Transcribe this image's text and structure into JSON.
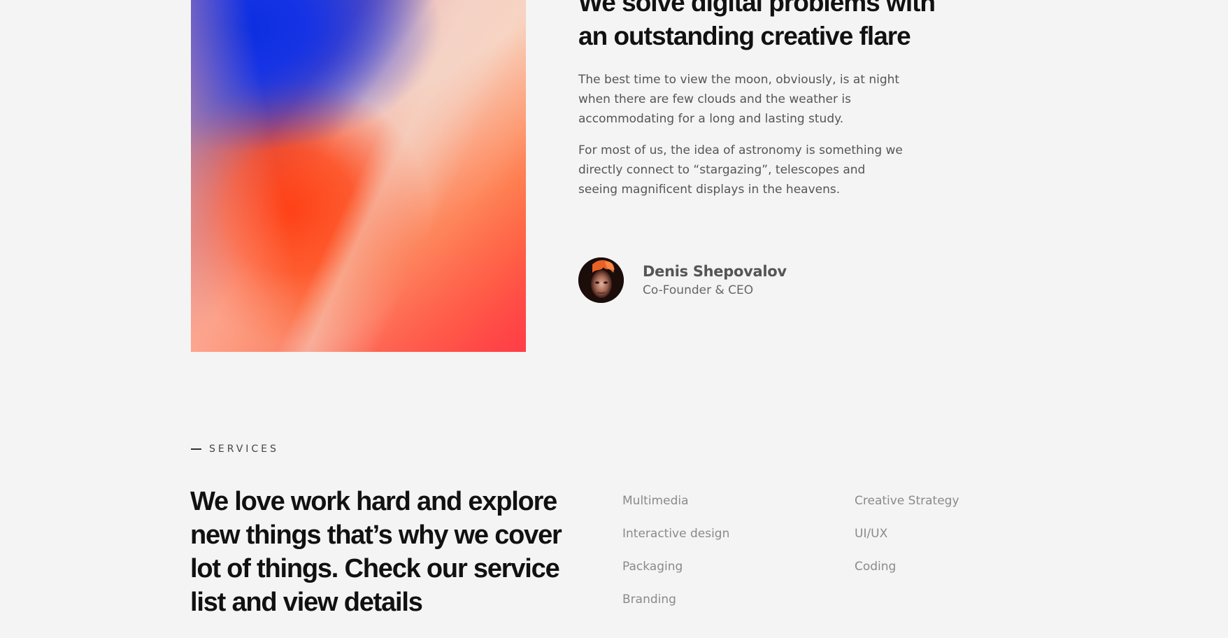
{
  "about": {
    "heading": "We solve digital problems with an outstanding creative flare",
    "paragraphs": [
      "The best time to view the moon, obviously, is at night when there are few clouds and the weather is accommodating for a long and lasting study.",
      "For most of us, the idea of astronomy is something we directly connect to “stargazing”, telescopes and seeing magnificent displays in the heavens."
    ],
    "author": {
      "name": "Denis Shepovalov",
      "role": "Co-Founder & CEO"
    }
  },
  "services": {
    "label": "SERVICES",
    "heading": "We love work hard and explore new things that’s why we cover lot of things. Check our service list and view details",
    "column_1": [
      "Multimedia",
      "Interactive design",
      "Packaging",
      "Branding"
    ],
    "column_2": [
      "Creative Strategy",
      "UI/UX",
      "Coding"
    ]
  },
  "colors": {
    "background": "#f4f4f4",
    "heading": "#111111",
    "body_text": "#555555",
    "service_text": "#8a8a8a"
  }
}
